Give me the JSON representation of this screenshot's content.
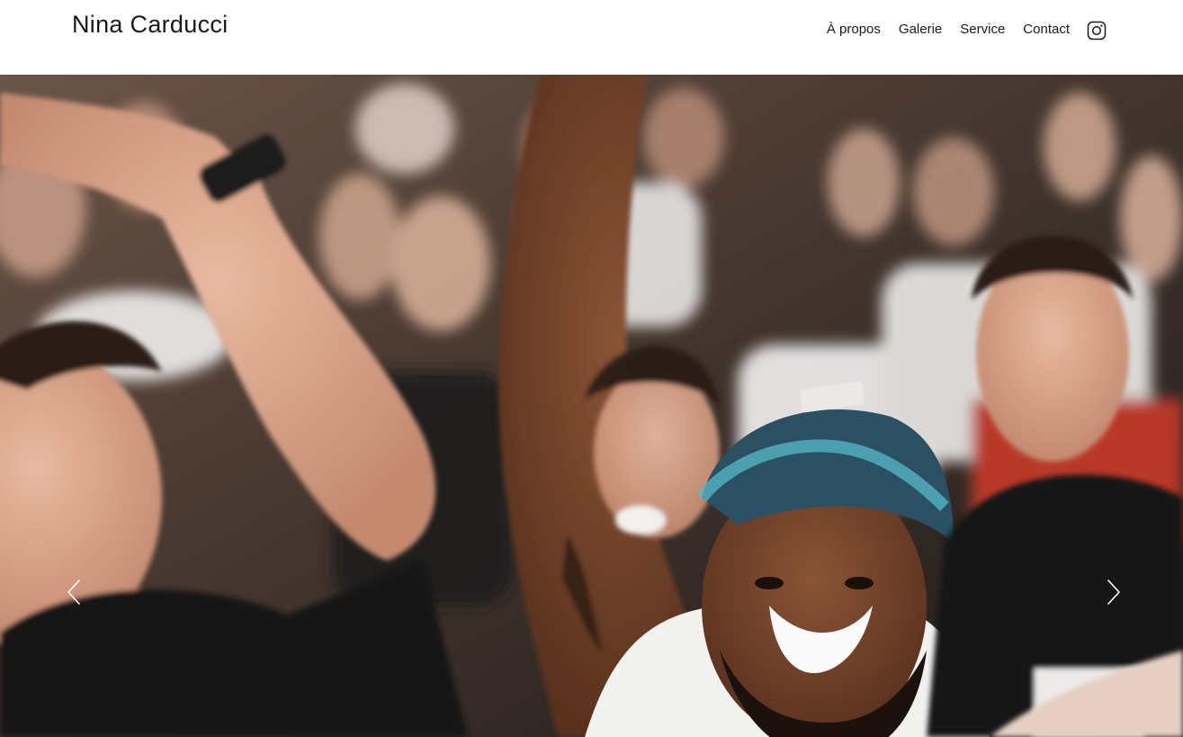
{
  "site": {
    "title": "Nina Carducci"
  },
  "nav": {
    "items": [
      {
        "label": "À propos"
      },
      {
        "label": "Galerie"
      },
      {
        "label": "Service"
      },
      {
        "label": "Contact"
      }
    ],
    "social_icon": "instagram-icon"
  },
  "hero": {
    "image_subject": "concert-crowd-photo",
    "prev_icon": "chevron-left-icon",
    "next_icon": "chevron-right-icon"
  },
  "colors": {
    "text": "#1a1a1a",
    "background": "#ffffff",
    "arrow": "#ffffff"
  }
}
